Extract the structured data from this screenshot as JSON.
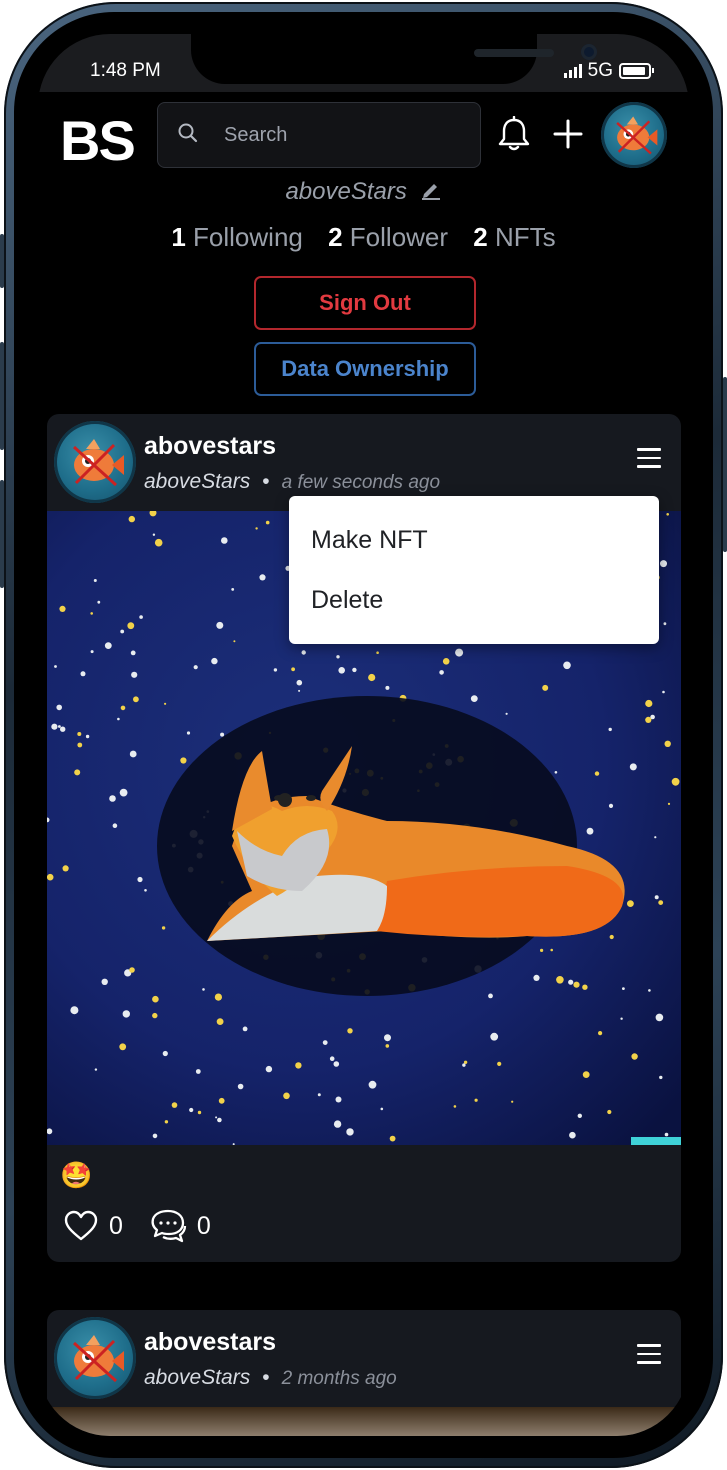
{
  "status_bar": {
    "time": "1:48 PM",
    "network": "5G"
  },
  "header": {
    "logo": "BS",
    "search": {
      "placeholder": "Search"
    }
  },
  "profile": {
    "handle": "aboveStars",
    "stats": [
      {
        "count": "1",
        "label": "Following"
      },
      {
        "count": "2",
        "label": "Follower"
      },
      {
        "count": "2",
        "label": "NFTs"
      }
    ],
    "sign_out_label": "Sign Out",
    "data_ownership_label": "Data Ownership"
  },
  "posts": [
    {
      "name": "abovestars",
      "handle": "aboveStars",
      "time_ago": "a few seconds ago",
      "reaction": "🤩",
      "likes": "0",
      "comments": "0"
    },
    {
      "name": "abovestars",
      "handle": "aboveStars",
      "time_ago": "2 months ago"
    }
  ],
  "post_menu": {
    "items": [
      "Make NFT",
      "Delete"
    ]
  },
  "colors": {
    "background": "#000000",
    "card": "#16191f",
    "sign_out": "#e23a40",
    "data_ownership": "#4b84cc"
  }
}
